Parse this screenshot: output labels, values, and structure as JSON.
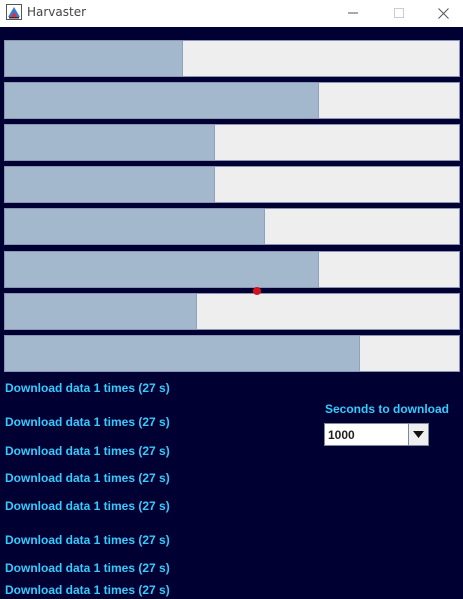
{
  "window": {
    "title": "Harvaster"
  },
  "progress_bars": [
    {
      "fill_percent": 39
    },
    {
      "fill_percent": 69
    },
    {
      "fill_percent": 46
    },
    {
      "fill_percent": 46
    },
    {
      "fill_percent": 57
    },
    {
      "fill_percent": 69
    },
    {
      "fill_percent": 42
    },
    {
      "fill_percent": 78
    }
  ],
  "download_labels": [
    "Download data 1 times (27 s)",
    "Download data 1 times (27 s)",
    "Download data 1 times (27 s)",
    "Download data 1 times (27 s)",
    "Download data 1 times (27 s)",
    "Download data 1 times (27 s)",
    "Download data 1 times (27 s)",
    "Download data 1 times (27 s)"
  ],
  "seconds_control": {
    "label": "Seconds to download",
    "selected_value": "1000"
  },
  "colors": {
    "background": "#000033",
    "label_text": "#33ccff",
    "bar_fill": "#a3b8cc",
    "bar_track": "#eeeeee",
    "marker": "#d4141a"
  },
  "icons": {
    "app": "harvaster-app-icon",
    "minimize": "minimize-icon",
    "maximize": "maximize-icon",
    "close": "close-icon",
    "dropdown": "triangle-down-icon"
  }
}
